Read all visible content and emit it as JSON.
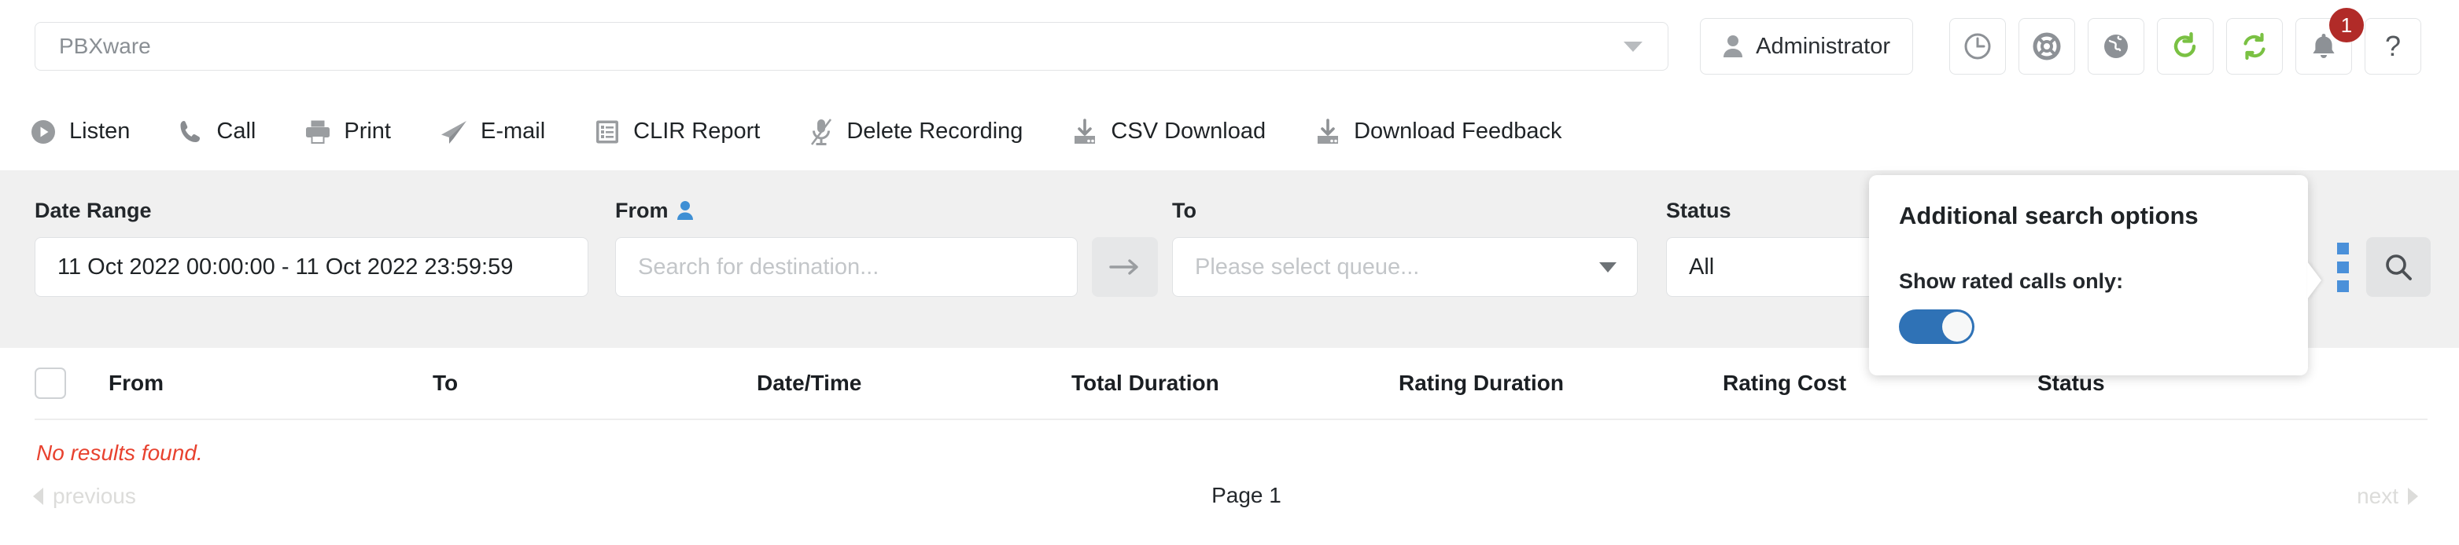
{
  "header": {
    "tenant_value": "PBXware",
    "tenant_caret_icon": "chevron-down-icon",
    "user_button_label": "Administrator",
    "user_icon": "user-icon",
    "icon_buttons": [
      {
        "name": "clock-icon",
        "title": "clock"
      },
      {
        "name": "lifebuoy-icon",
        "title": "support"
      },
      {
        "name": "globe-icon",
        "title": "globe"
      },
      {
        "name": "reload-icon",
        "title": "reload"
      },
      {
        "name": "sync-icon",
        "title": "sync"
      },
      {
        "name": "bell-icon",
        "title": "notifications"
      },
      {
        "name": "help-icon",
        "title": "help"
      }
    ],
    "notification_count": "1",
    "help_glyph": "?",
    "badge_color": "#b12b28",
    "green_accent": "#7ac143"
  },
  "toolbar": {
    "items": [
      {
        "label": "Listen",
        "icon": "play-circle-icon"
      },
      {
        "label": "Call",
        "icon": "phone-icon"
      },
      {
        "label": "Print",
        "icon": "printer-icon"
      },
      {
        "label": "E-mail",
        "icon": "paper-plane-icon"
      },
      {
        "label": "CLIR Report",
        "icon": "list-report-icon"
      },
      {
        "label": "Delete Recording",
        "icon": "microphone-slash-icon"
      },
      {
        "label": "CSV Download",
        "icon": "download-icon"
      },
      {
        "label": "Download Feedback",
        "icon": "download-icon"
      }
    ]
  },
  "filters": {
    "date_range": {
      "label": "Date Range",
      "value": "11 Oct 2022 00:00:00 - 11 Oct 2022 23:59:59"
    },
    "from": {
      "label": "From",
      "icon": "user-blue-icon",
      "value": "",
      "placeholder": "Search for destination..."
    },
    "swap": {
      "icon": "arrow-right-icon"
    },
    "to": {
      "label": "To",
      "value": "",
      "placeholder": "Please select queue..."
    },
    "status": {
      "label": "Status",
      "value": "All"
    },
    "more_options_icon": "dots-vertical-icon",
    "search_button_icon": "search-icon"
  },
  "popup": {
    "title": "Additional search options",
    "toggle_label": "Show rated calls only:",
    "toggle_state": "on",
    "toggle_color": "#2f72b6"
  },
  "table": {
    "columns": [
      "From",
      "To",
      "Date/Time",
      "Total Duration",
      "Rating Duration",
      "Rating Cost",
      "Status"
    ],
    "select_all_checkbox": "unchecked",
    "empty_message": "No results found.",
    "empty_color": "#e8422f",
    "rows": []
  },
  "pagination": {
    "previous_label": "previous",
    "next_label": "next",
    "page_label": "Page 1",
    "prev_icon": "triangle-left-icon",
    "next_icon": "triangle-right-icon",
    "prev_enabled": "false",
    "next_enabled": "false"
  }
}
